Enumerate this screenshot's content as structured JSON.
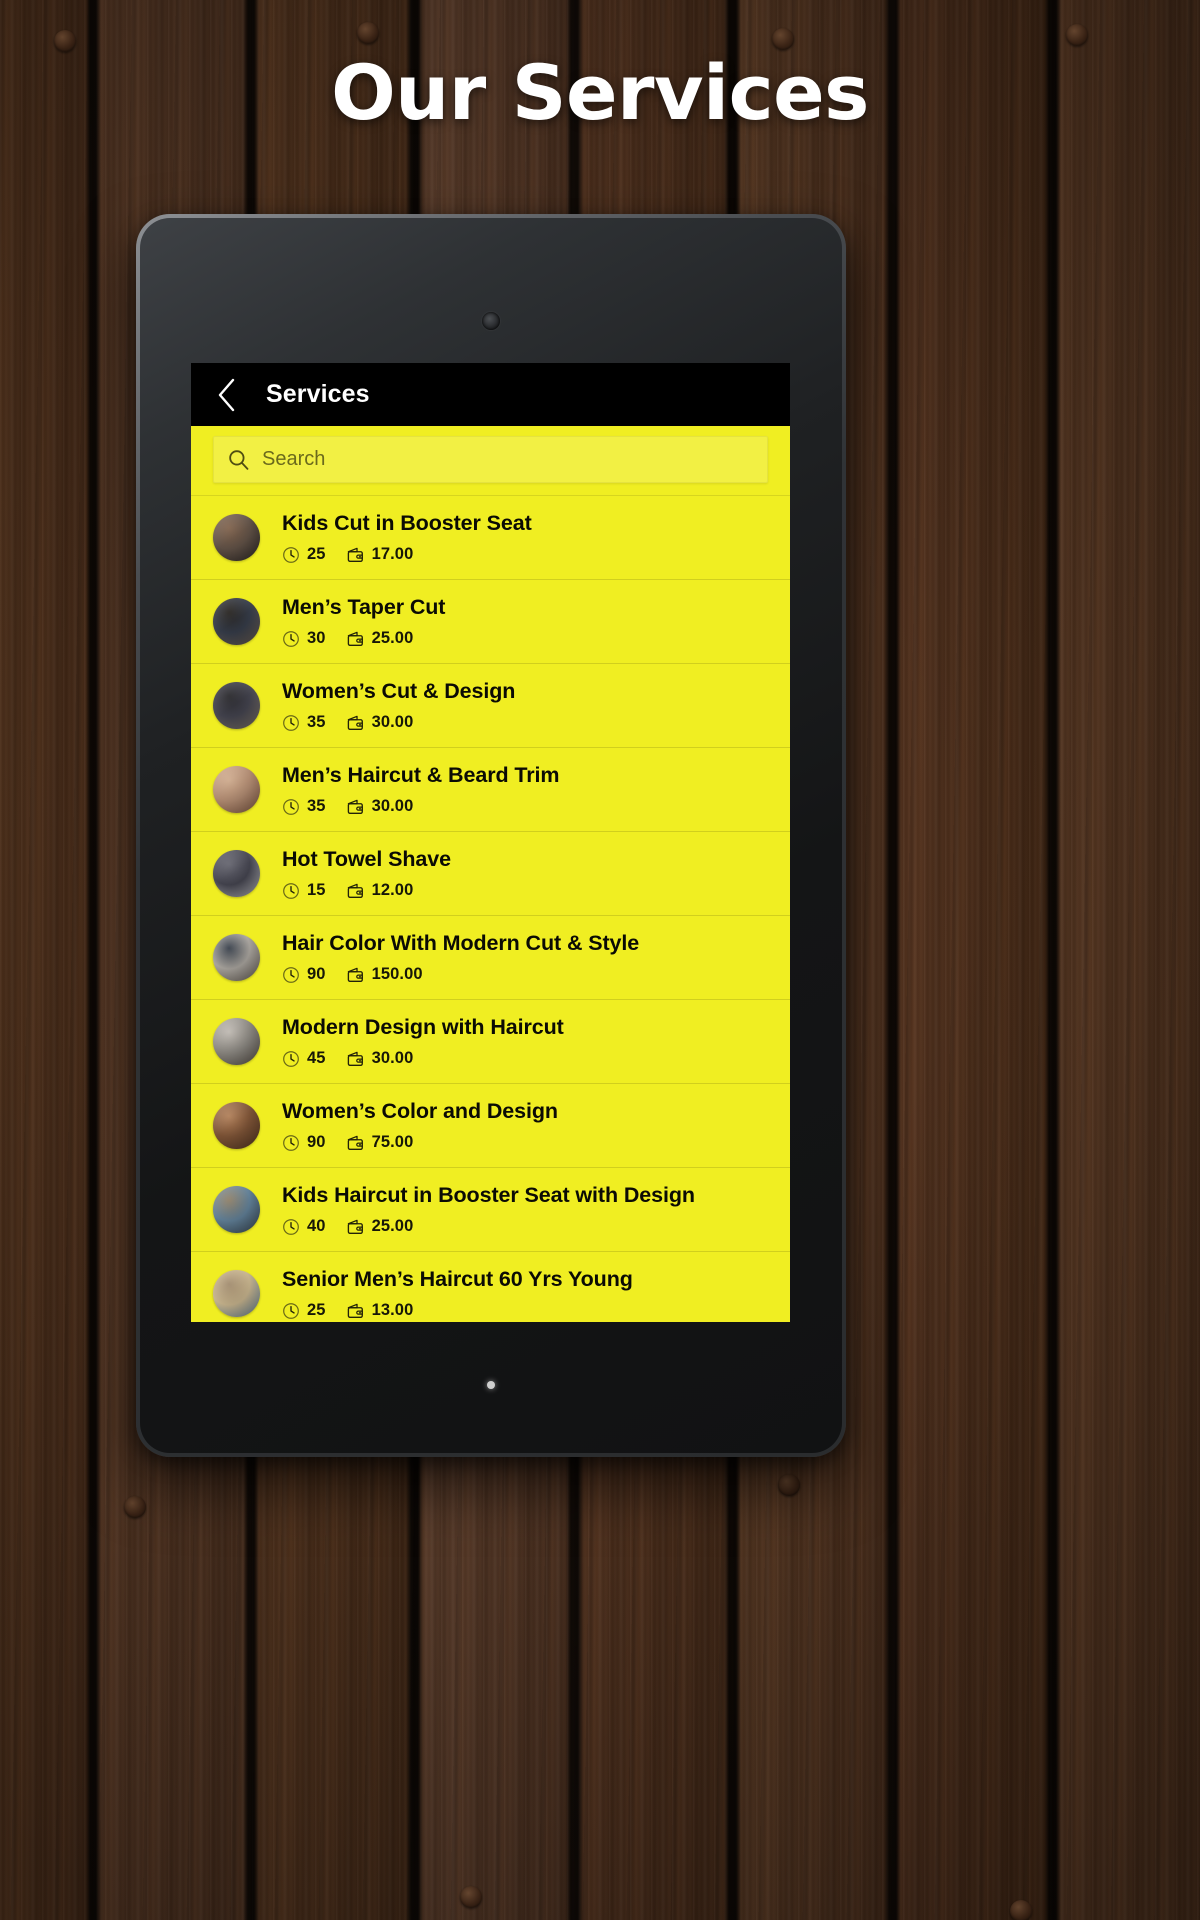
{
  "poster": {
    "heading": "Our Services"
  },
  "device": {
    "camera_icon": "front-camera-dot",
    "led_icon": "status-led-dot"
  },
  "app": {
    "appbar": {
      "back_icon": "chevron-left-icon",
      "title": "Services"
    },
    "search": {
      "icon": "search-icon",
      "placeholder": "Search",
      "value": ""
    },
    "colors": {
      "screen_background": "#f0ee22",
      "search_field": "#f2f044",
      "appbar": "#000000",
      "title_text": "#0b0b04",
      "meta_text": "#171707",
      "divider": "rgba(0,0,0,0.13)"
    },
    "meta_icons": {
      "duration": "clock-icon",
      "price": "wallet-icon"
    },
    "services": [
      {
        "name": "Kids Cut in Booster Seat",
        "duration": "25",
        "price": "17.00",
        "avatar_colors": [
          "#6b5a4e",
          "#2f2a28",
          "#8a6a52"
        ]
      },
      {
        "name": "Men’s Taper Cut",
        "duration": "30",
        "price": "25.00",
        "avatar_colors": [
          "#3b4250",
          "#7a6a5c",
          "#2a2622"
        ]
      },
      {
        "name": "Women’s Cut & Design",
        "duration": "35",
        "price": "30.00",
        "avatar_colors": [
          "#4a4a56",
          "#8f8376",
          "#2b2a2e"
        ]
      },
      {
        "name": "Men’s Haircut & Beard Trim",
        "duration": "35",
        "price": "30.00",
        "avatar_colors": [
          "#c49a7e",
          "#8a6048",
          "#e0b999"
        ]
      },
      {
        "name": "Hot Towel Shave",
        "duration": "15",
        "price": "12.00",
        "avatar_colors": [
          "#4b4b57",
          "#cfcfd4",
          "#6d6d78"
        ]
      },
      {
        "name": "Hair Color With Modern Cut & Style",
        "duration": "90",
        "price": "150.00",
        "avatar_colors": [
          "#b9b4ad",
          "#6e655c",
          "#3c4450"
        ]
      },
      {
        "name": "Modern Design with Haircut",
        "duration": "45",
        "price": "30.00",
        "avatar_colors": [
          "#9a968f",
          "#5c544c",
          "#cfc9c1"
        ]
      },
      {
        "name": "Women’s Color and Design",
        "duration": "90",
        "price": "75.00",
        "avatar_colors": [
          "#8a5c3c",
          "#5a3a24",
          "#c08a60"
        ]
      },
      {
        "name": "Kids Haircut in Booster Seat with Design",
        "duration": "40",
        "price": "25.00",
        "avatar_colors": [
          "#6a8ca6",
          "#3e4c58",
          "#9a8a70"
        ]
      },
      {
        "name": "Senior Men’s Haircut 60 Yrs Young",
        "duration": "25",
        "price": "13.00",
        "avatar_colors": [
          "#d9c49a",
          "#6c8fa8",
          "#b09878"
        ]
      }
    ]
  }
}
